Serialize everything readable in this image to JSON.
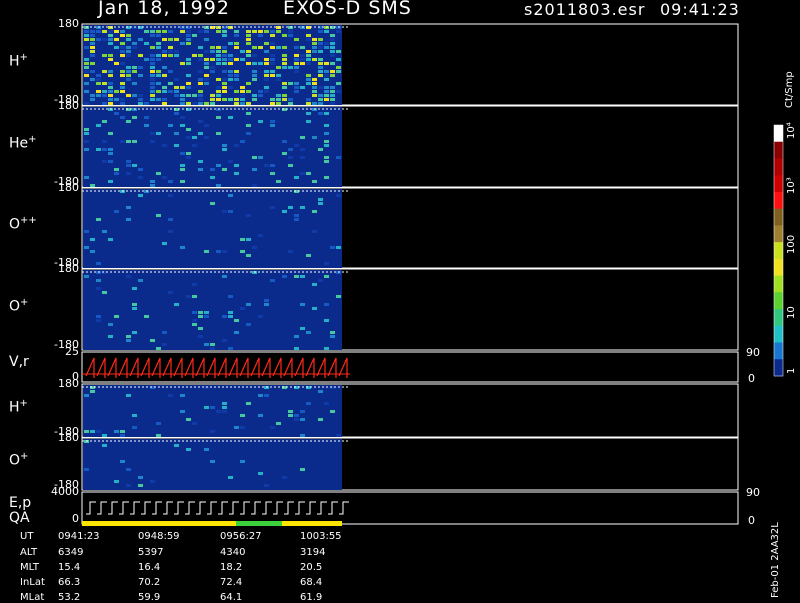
{
  "header": {
    "date": "Jan 18, 1992",
    "mission": "EXOS-D SMS",
    "file": "s2011803.esr",
    "time": "09:41:23"
  },
  "colors": {
    "background": "#000000",
    "panel_fill": "#0a2a8c",
    "frame": "#ffffff",
    "velocity_trace": "#ff2a1a",
    "qa_yellow": "#ffe600",
    "qa_green": "#3cd23c"
  },
  "chart_data": {
    "type": "heatmap",
    "panels": [
      {
        "id": "h-plus",
        "label": "H",
        "superscript": "+",
        "ymax": "180",
        "ymin": "-180",
        "ylim": [
          -180,
          180
        ]
      },
      {
        "id": "he-plus",
        "label": "He",
        "superscript": "+",
        "ymax": "180",
        "ymin": "-180",
        "ylim": [
          -180,
          180
        ]
      },
      {
        "id": "o-plusplus",
        "label": "O",
        "superscript": "++",
        "ymax": "180",
        "ymin": "-180",
        "ylim": [
          -180,
          180
        ]
      },
      {
        "id": "o-plus",
        "label": "O",
        "superscript": "+",
        "ymax": "180",
        "ymin": "-180",
        "ylim": [
          -180,
          180
        ]
      },
      {
        "id": "v-r",
        "label": "V,r",
        "superscript": "",
        "ymax": "25",
        "ymin": "0",
        "right_top": "90",
        "right_bottom": "0"
      },
      {
        "id": "h-plus-2",
        "label": "H",
        "superscript": "+",
        "ymax": "180",
        "ymin": "-180",
        "ylim": [
          -180,
          180
        ]
      },
      {
        "id": "o-plus-2",
        "label": "O",
        "superscript": "+",
        "ymax": "180",
        "ymin": "-180",
        "ylim": [
          -180,
          180
        ]
      },
      {
        "id": "e-p-qa",
        "label": "E,p",
        "label2": "QA",
        "superscript": "",
        "ymax": "4000",
        "ymin": "0",
        "right_top": "90",
        "right_bottom": "0"
      }
    ],
    "colorbar": {
      "unit": "Ct/Smp",
      "ticks": [
        "10⁴",
        "10³",
        "100",
        "10",
        "1"
      ],
      "scale": "log",
      "range": [
        1,
        10000
      ]
    },
    "qa_bar": [
      {
        "from": "0941:23",
        "to": "0956:27",
        "status": "yellow"
      },
      {
        "from": "0956:27",
        "to": "0999:00",
        "status": "green"
      },
      {
        "from": "0999:00",
        "to": "1007:00",
        "status": "yellow"
      }
    ]
  },
  "ephemeris": {
    "row_labels": [
      "UT",
      "ALT",
      "MLT",
      "InLat",
      "MLat"
    ],
    "columns": [
      {
        "values": [
          "0941:23",
          "6349",
          "15.4",
          "66.3",
          "53.2"
        ]
      },
      {
        "values": [
          "0948:59",
          "5397",
          "16.4",
          "70.2",
          "59.9"
        ]
      },
      {
        "values": [
          "0956:27",
          "4340",
          "18.2",
          "72.4",
          "64.1"
        ]
      },
      {
        "values": [
          "1003:55",
          "3194",
          "20.5",
          "68.4",
          "61.9"
        ]
      }
    ]
  },
  "footer_id": "Feb-01 2AA32L"
}
